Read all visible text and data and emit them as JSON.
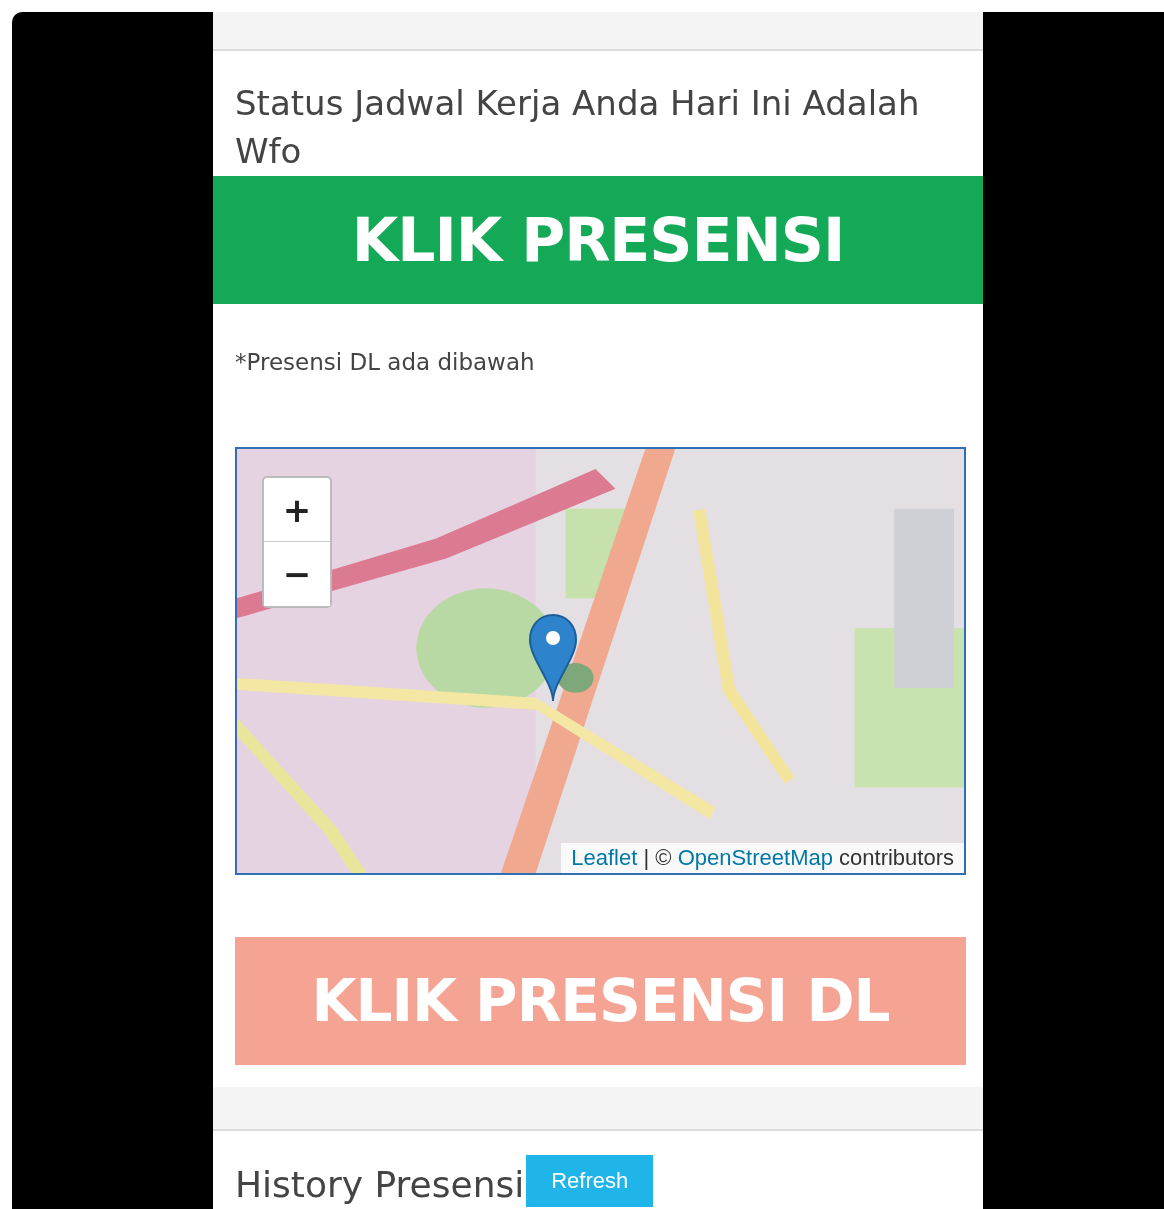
{
  "status_text": "Status Jadwal Kerja Anda Hari Ini Adalah Wfo",
  "presensi_button": "KLIK PRESENSI",
  "note": "*Presensi DL ada dibawah",
  "map": {
    "kind": "picture",
    "zoom_in": "+",
    "zoom_out": "−",
    "attribution": {
      "leaflet_link": "Leaflet",
      "separator": "|",
      "copyright": "©",
      "osm_link": "OpenStreetMap",
      "suffix": "contributors"
    }
  },
  "presensi_dl_button": "KLIK PRESENSI DL",
  "history": {
    "title": "History Presensi",
    "refresh_button": "Refresh"
  }
}
